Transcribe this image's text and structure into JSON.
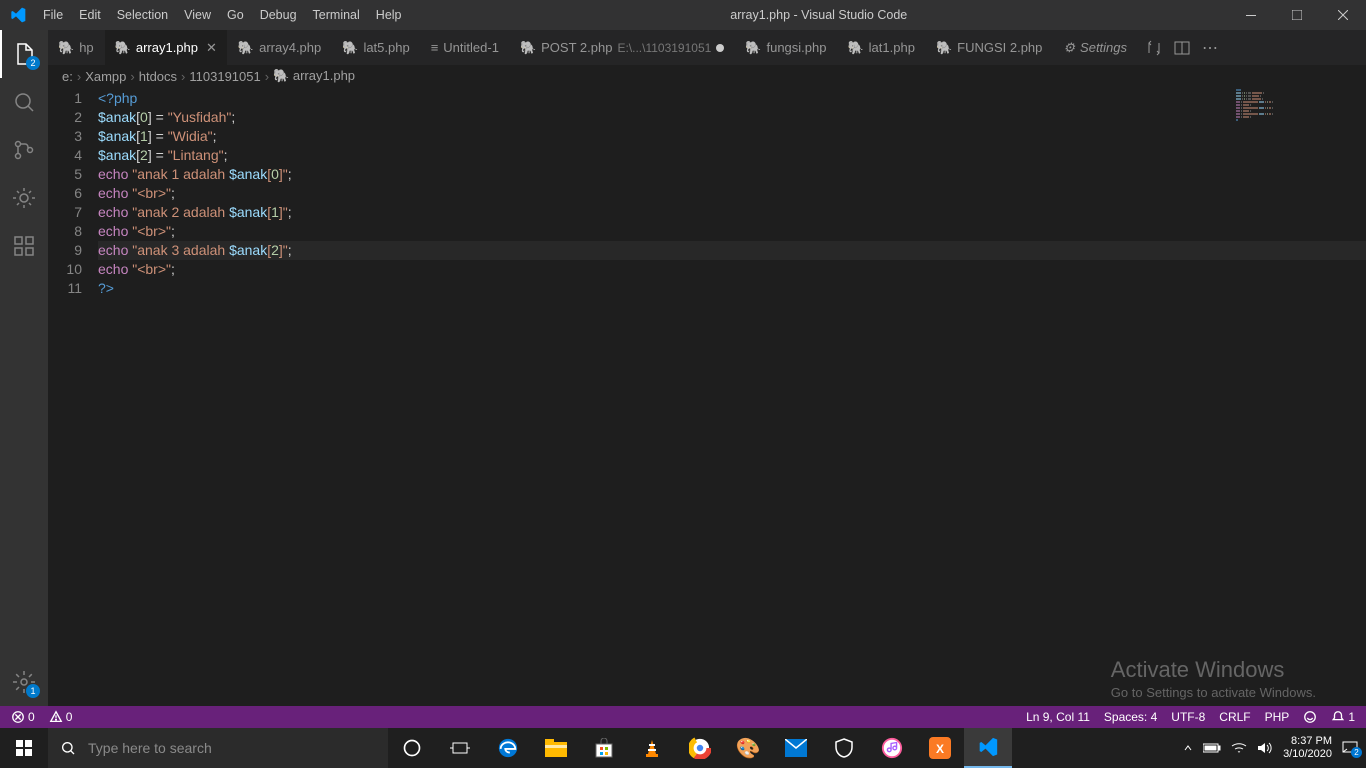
{
  "titlebar": {
    "menus": [
      "File",
      "Edit",
      "Selection",
      "View",
      "Go",
      "Debug",
      "Terminal",
      "Help"
    ],
    "title": "array1.php - Visual Studio Code"
  },
  "activitybar": {
    "explorer_badge": "2",
    "settings_badge": "1"
  },
  "tabs": [
    {
      "label": "hp",
      "icon": "php",
      "active": false
    },
    {
      "label": "array1.php",
      "icon": "php",
      "active": true,
      "close": true
    },
    {
      "label": "array4.php",
      "icon": "php",
      "active": false
    },
    {
      "label": "lat5.php",
      "icon": "php",
      "active": false
    },
    {
      "label": "Untitled-1",
      "icon": "text",
      "active": false
    },
    {
      "label": "POST 2.php",
      "suffix": "E:\\...\\1103191051",
      "icon": "php",
      "active": false,
      "dirty": true
    },
    {
      "label": "fungsi.php",
      "icon": "php",
      "active": false
    },
    {
      "label": "lat1.php",
      "icon": "php",
      "active": false
    },
    {
      "label": "FUNGSI 2.php",
      "icon": "php",
      "active": false
    },
    {
      "label": "Settings",
      "icon": "gear",
      "active": false,
      "italic": true
    }
  ],
  "breadcrumb": [
    "e:",
    "Xampp",
    "htdocs",
    "1103191051",
    "array1.php"
  ],
  "code": {
    "lines": [
      {
        "n": 1,
        "tokens": [
          {
            "t": "<?php",
            "c": "c-tag"
          }
        ]
      },
      {
        "n": 2,
        "tokens": [
          {
            "t": "$anak",
            "c": "c-var"
          },
          {
            "t": "[",
            "c": "c-punc"
          },
          {
            "t": "0",
            "c": "c-num"
          },
          {
            "t": "]",
            "c": "c-punc"
          },
          {
            "t": " = ",
            "c": "c-punc"
          },
          {
            "t": "\"Yusfidah\"",
            "c": "c-str"
          },
          {
            "t": ";",
            "c": "c-punc"
          }
        ]
      },
      {
        "n": 3,
        "tokens": [
          {
            "t": "$anak",
            "c": "c-var"
          },
          {
            "t": "[",
            "c": "c-punc"
          },
          {
            "t": "1",
            "c": "c-num"
          },
          {
            "t": "]",
            "c": "c-punc"
          },
          {
            "t": " = ",
            "c": "c-punc"
          },
          {
            "t": "\"Widia\"",
            "c": "c-str"
          },
          {
            "t": ";",
            "c": "c-punc"
          }
        ]
      },
      {
        "n": 4,
        "tokens": [
          {
            "t": "$anak",
            "c": "c-var"
          },
          {
            "t": "[",
            "c": "c-punc"
          },
          {
            "t": "2",
            "c": "c-num"
          },
          {
            "t": "]",
            "c": "c-punc"
          },
          {
            "t": " = ",
            "c": "c-punc"
          },
          {
            "t": "\"Lintang\"",
            "c": "c-str"
          },
          {
            "t": ";",
            "c": "c-punc"
          }
        ]
      },
      {
        "n": 5,
        "tokens": [
          {
            "t": "echo",
            "c": "c-key"
          },
          {
            "t": " ",
            "c": ""
          },
          {
            "t": "\"anak 1 adalah ",
            "c": "c-str"
          },
          {
            "t": "$anak",
            "c": "c-var"
          },
          {
            "t": "[",
            "c": "c-str"
          },
          {
            "t": "0",
            "c": "c-num"
          },
          {
            "t": "]\"",
            "c": "c-str"
          },
          {
            "t": ";",
            "c": "c-punc"
          }
        ]
      },
      {
        "n": 6,
        "tokens": [
          {
            "t": "echo",
            "c": "c-key"
          },
          {
            "t": " ",
            "c": ""
          },
          {
            "t": "\"<br>\"",
            "c": "c-str"
          },
          {
            "t": ";",
            "c": "c-punc"
          }
        ]
      },
      {
        "n": 7,
        "tokens": [
          {
            "t": "echo",
            "c": "c-key"
          },
          {
            "t": " ",
            "c": ""
          },
          {
            "t": "\"anak 2 adalah ",
            "c": "c-str"
          },
          {
            "t": "$anak",
            "c": "c-var"
          },
          {
            "t": "[",
            "c": "c-str"
          },
          {
            "t": "1",
            "c": "c-num"
          },
          {
            "t": "]\"",
            "c": "c-str"
          },
          {
            "t": ";",
            "c": "c-punc"
          }
        ]
      },
      {
        "n": 8,
        "tokens": [
          {
            "t": "echo",
            "c": "c-key"
          },
          {
            "t": " ",
            "c": ""
          },
          {
            "t": "\"<br>\"",
            "c": "c-str"
          },
          {
            "t": ";",
            "c": "c-punc"
          }
        ]
      },
      {
        "n": 9,
        "hl": true,
        "tokens": [
          {
            "t": "echo",
            "c": "c-key"
          },
          {
            "t": " ",
            "c": ""
          },
          {
            "t": "\"anak 3 adalah ",
            "c": "c-str"
          },
          {
            "t": "$anak",
            "c": "c-var"
          },
          {
            "t": "[",
            "c": "c-str"
          },
          {
            "t": "2",
            "c": "c-num"
          },
          {
            "t": "]\"",
            "c": "c-str"
          },
          {
            "t": ";",
            "c": "c-punc"
          }
        ]
      },
      {
        "n": 10,
        "tokens": [
          {
            "t": "echo",
            "c": "c-key"
          },
          {
            "t": " ",
            "c": ""
          },
          {
            "t": "\"<br>\"",
            "c": "c-str"
          },
          {
            "t": ";",
            "c": "c-punc"
          }
        ]
      },
      {
        "n": 11,
        "tokens": [
          {
            "t": "?>",
            "c": "c-tag"
          }
        ]
      }
    ]
  },
  "watermark": {
    "title": "Activate Windows",
    "sub": "Go to Settings to activate Windows."
  },
  "statusbar": {
    "errors": "0",
    "warnings": "0",
    "cursor": "Ln 9, Col 11",
    "spaces": "Spaces: 4",
    "encoding": "UTF-8",
    "eol": "CRLF",
    "lang": "PHP",
    "notif": "1"
  },
  "taskbar": {
    "search_placeholder": "Type here to search",
    "time": "8:37 PM",
    "date": "3/10/2020",
    "notif": "2"
  }
}
